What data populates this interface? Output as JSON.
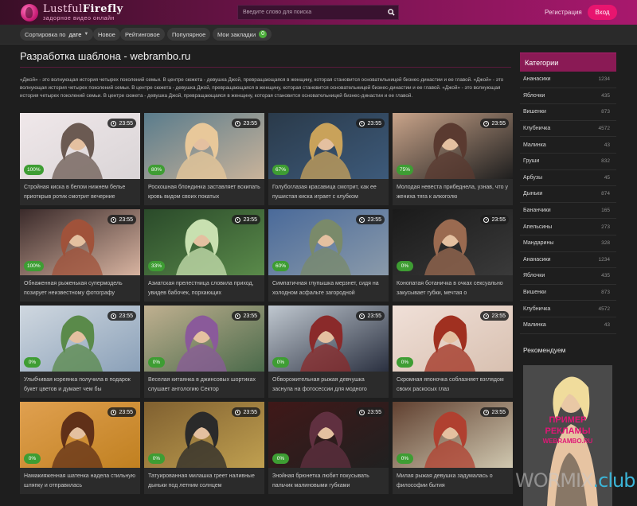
{
  "header": {
    "logo_part1": "Lustful",
    "logo_part2": "Firefly",
    "logo_subtitle": "задорное видео онлайн",
    "search_placeholder": "Введите слово для поиска",
    "register": "Регистрация",
    "login": "Вход"
  },
  "subnav": {
    "sort_label": "Сортировка по",
    "sort_value": "дате",
    "new": "Новое",
    "top_rated": "Рейтинговое",
    "popular": "Популярное",
    "bookmarks": "Мои закладки",
    "bookmarks_count": "0"
  },
  "main": {
    "title": "Разработка шаблона - webrambo.ru",
    "description": "«Джой» - это волнующая история четырех поколений семьи. В центре сюжета - девушка Джой, превращающаяся в женщину, которая становится основательницей бизнес-династии и ее главой. «Джой» - это волнующая история четырех поколений семьи. В центре сюжета - девушка Джой, превращающаяся в женщину, которая становится основательницей бизнес-династии и ее главой. «Джой» - это волнующая история четырех поколений семьи. В центре сюжета - девушка Джой, превращающаяся в женщину, которая становится основательницей бизнес-династии и ее главой."
  },
  "videos": [
    {
      "time": "23:55",
      "rating": "100%",
      "title": "Стройная киска в белом нижнем белье приоткрыв ротик смотрит вечерние"
    },
    {
      "time": "23:55",
      "rating": "80%",
      "title": "Роскошная блондинка заставляет вскипать кровь видом своих покатых"
    },
    {
      "time": "23:55",
      "rating": "67%",
      "title": "Голубоглазая красавица смотрит, как ее пушистая киска играет с клубком"
    },
    {
      "time": "23:55",
      "rating": "75%",
      "title": "Молодая невеста прибеднела, узнав, что у жениха тяга к алкоголю"
    },
    {
      "time": "23:55",
      "rating": "100%",
      "title": "Обнаженная рыженькая супермодель позирует неизвестному фотографу"
    },
    {
      "time": "23:55",
      "rating": "33%",
      "title": "Азиатская прелестница словила приход, увидев бабочек, порхающих"
    },
    {
      "time": "23:55",
      "rating": "60%",
      "title": "Симпатичная глупышка мерзнет, сидя на холодном асфальте загородной"
    },
    {
      "time": "23:55",
      "rating": "0%",
      "title": "Конопатая ботаничка в очках сексуально закусывает губки, мечтая о"
    },
    {
      "time": "23:55",
      "rating": "0%",
      "title": "Улыбчивая кореянка получила в подарок букет цветов и думает чем бы"
    },
    {
      "time": "23:55",
      "rating": "0%",
      "title": "Веселая китаянка в джинсовых шортиках слушает антологию Сектор"
    },
    {
      "time": "23:55",
      "rating": "0%",
      "title": "Обворожительная рыжая девчушка заснула на фотосессии для модного"
    },
    {
      "time": "23:55",
      "rating": "0%",
      "title": "Скромная японочка соблазняет взглядом своих раскосых глаз"
    },
    {
      "time": "23:55",
      "rating": "0%",
      "title": "Намакияженная шатенка надела стильную шляпку и отправилась"
    },
    {
      "time": "23:55",
      "rating": "0%",
      "title": "Татуированная милашка греет наливные дыньки под летним солнцем"
    },
    {
      "time": "23:55",
      "rating": "0%",
      "title": "Знойная брюнетка любит покусывать пальчик малиновыми губками"
    },
    {
      "time": "23:55",
      "rating": "0%",
      "title": "Милая рыжая девушка задумалась о философии бытия"
    }
  ],
  "sidebar": {
    "categories_title": "Категории",
    "categories": [
      {
        "name": "Ананасики",
        "count": "1234"
      },
      {
        "name": "Яблочки",
        "count": "435"
      },
      {
        "name": "Вишенки",
        "count": "873"
      },
      {
        "name": "Клубничка",
        "count": "4572"
      },
      {
        "name": "Малинка",
        "count": "43"
      },
      {
        "name": "Груши",
        "count": "832"
      },
      {
        "name": "Арбузы",
        "count": "45"
      },
      {
        "name": "Дыньки",
        "count": "874"
      },
      {
        "name": "Бананчики",
        "count": "165"
      },
      {
        "name": "Апельсины",
        "count": "273"
      },
      {
        "name": "Мандарины",
        "count": "328"
      },
      {
        "name": "Ананасики",
        "count": "1234"
      },
      {
        "name": "Яблочки",
        "count": "435"
      },
      {
        "name": "Вишенки",
        "count": "873"
      },
      {
        "name": "Клубничка",
        "count": "4572"
      },
      {
        "name": "Малинка",
        "count": "43"
      }
    ],
    "recommended_title": "Рекомендуем",
    "ad_line1": "ПРИМЕР",
    "ad_line2": "РЕКЛАМЫ",
    "ad_line3": "WEBRAMBO.RU"
  },
  "watermark": {
    "part1": "WORMIX",
    "part2": ".club"
  },
  "colors": {
    "accent": "#e8156f",
    "header_dark": "#3a0f27",
    "header_light": "#a8186d",
    "rating_green": "#3e9d33",
    "background": "#1e1e1e"
  }
}
